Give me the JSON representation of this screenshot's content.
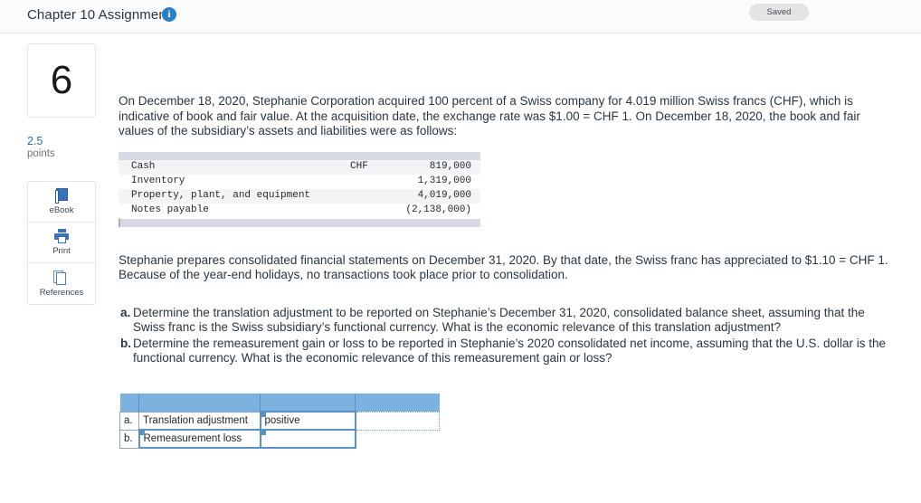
{
  "header": {
    "title": "Chapter 10 Assignment",
    "info_icon": "info-icon",
    "saved_label": "Saved"
  },
  "sidebar": {
    "question_number": "6",
    "points_value": "2.5",
    "points_label": "points",
    "tools": [
      {
        "label": "eBook",
        "icon": "book-icon"
      },
      {
        "label": "Print",
        "icon": "printer-icon"
      },
      {
        "label": "References",
        "icon": "pages-icon"
      }
    ]
  },
  "main": {
    "paragraph_1": "On December 18, 2020, Stephanie Corporation acquired 100 percent of a Swiss company for 4.019 million Swiss francs (CHF), which is indicative of book and fair value. At the acquisition date, the exchange rate was $1.00 = CHF 1. On December 18, 2020, the book and fair values of the subsidiary’s assets and liabilities were as follows:",
    "paragraph_2": "Stephanie prepares consolidated financial statements on December 31, 2020. By that date, the Swiss franc has appreciated to $1.10 = CHF 1. Because of the year-end holidays, no transactions took place prior to consolidation.",
    "financial_table": {
      "rows": [
        {
          "label": "Cash",
          "currency": "CHF",
          "amount": "819,000"
        },
        {
          "label": "Inventory",
          "currency": "",
          "amount": "1,319,000"
        },
        {
          "label": "Property, plant, and equipment",
          "currency": "",
          "amount": "4,019,000"
        },
        {
          "label": "Notes payable",
          "currency": "",
          "amount": "(2,138,000)"
        }
      ]
    },
    "questions": [
      {
        "marker": "a.",
        "text": "Determine the translation adjustment to be reported on Stephanie’s December 31, 2020, consolidated balance sheet, assuming that the Swiss franc is the Swiss subsidiary’s functional currency. What is the economic relevance of this translation adjustment?"
      },
      {
        "marker": "b.",
        "text": "Determine the remeasurement gain or loss to be reported in Stephanie’s 2020 consolidated net income, assuming that the U.S. dollar is the functional currency. What is the economic relevance of this remeasurement gain or loss?"
      }
    ],
    "answer_table": {
      "rows": [
        {
          "marker": "a.",
          "label": "Translation adjustment",
          "value": "positive",
          "extra": ""
        },
        {
          "marker": "b.",
          "label": "Remeasurement loss",
          "value": "",
          "extra": ""
        }
      ]
    }
  },
  "colors": {
    "accent_blue": "#2a7fc9",
    "header_blue": "#7cb2e0",
    "points_blue": "#2f6fa8",
    "table_header_gray": "#d7d9e4"
  }
}
